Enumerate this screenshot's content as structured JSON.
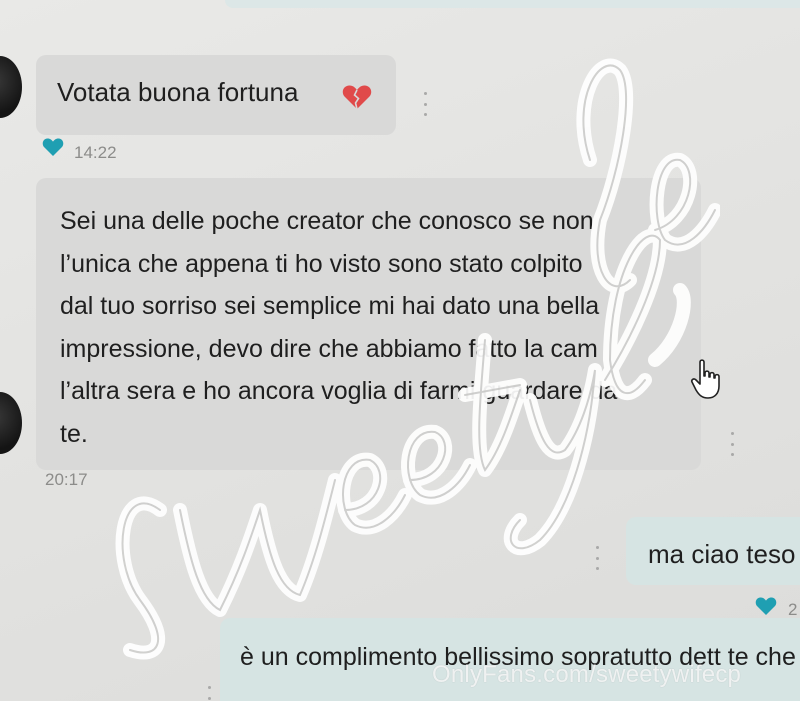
{
  "messages": [
    {
      "direction": "incoming",
      "text": "Votata buona fortuna",
      "emoji": "broken-heart-icon",
      "time": "14:22"
    },
    {
      "direction": "incoming",
      "text": "Sei una delle poche creator che conosco se non\nl’unica che appena ti ho visto sono stato colpito\ndal tuo sorriso sei semplice mi hai dato una bella\nimpressione, devo dire che abbiamo fatto la cam\nl’altra sera e ho ancora voglia di farmi guardare da\nte.",
      "time": "20:17"
    },
    {
      "direction": "outgoing",
      "text": "ma ciao teso",
      "time": "2"
    },
    {
      "direction": "outgoing",
      "text": "è un complimento bellissimo sopratutto dett\nte che sei cmq un creator, mi lusinga"
    }
  ],
  "watermark": {
    "signature_text": "sweetywife",
    "footer_text": "OnlyFans.com/sweetywifecp"
  },
  "colors": {
    "background": "#e3e3e1",
    "incoming_bubble": "#d9d9d8",
    "outgoing_bubble": "#d6e4e3",
    "teal_heart": "#1f9fb2",
    "red_heart": "#e04a4a"
  }
}
